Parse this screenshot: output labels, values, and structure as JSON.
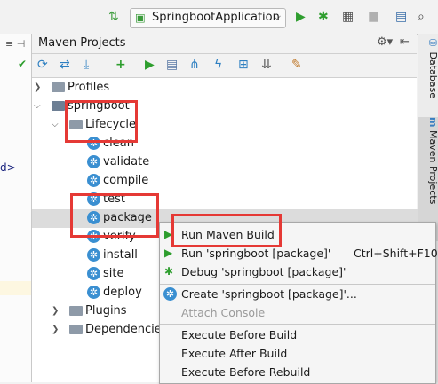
{
  "toolbar": {
    "run_config": "SpringbootApplication",
    "icons": [
      "sort-icon",
      "run-icon",
      "debug-icon",
      "coverage-icon",
      "stop-icon",
      "structure-icon",
      "search-icon"
    ]
  },
  "editor_strip": {
    "bracket_text": "d>"
  },
  "panel": {
    "title": "Maven Projects",
    "gear_glyph": "⚙▾",
    "hide_glyph": "⇤"
  },
  "tree": {
    "profiles": "Profiles",
    "project": "springboot",
    "lifecycle": "Lifecycle",
    "goals": [
      "clean",
      "validate",
      "compile",
      "test",
      "package",
      "verify",
      "install",
      "site",
      "deploy"
    ],
    "plugins": "Plugins",
    "dependencies": "Dependencies"
  },
  "right_tabs": {
    "database": "Database",
    "maven": "Maven Projects"
  },
  "context_menu": {
    "run_maven_build": "Run Maven Build",
    "run_package": "Run 'springboot [package]'",
    "run_shortcut": "Ctrl+Shift+F10",
    "debug_package": "Debug 'springboot [package]'",
    "create_package": "Create 'springboot [package]'...",
    "attach_console": "Attach Console",
    "execute_before_build": "Execute Before Build",
    "execute_after_build": "Execute After Build",
    "execute_before_rebuild": "Execute Before Rebuild"
  },
  "colors": {
    "highlight_red": "#e53935",
    "run_green": "#3aa33a",
    "gear_blue": "#3a8fd1"
  }
}
